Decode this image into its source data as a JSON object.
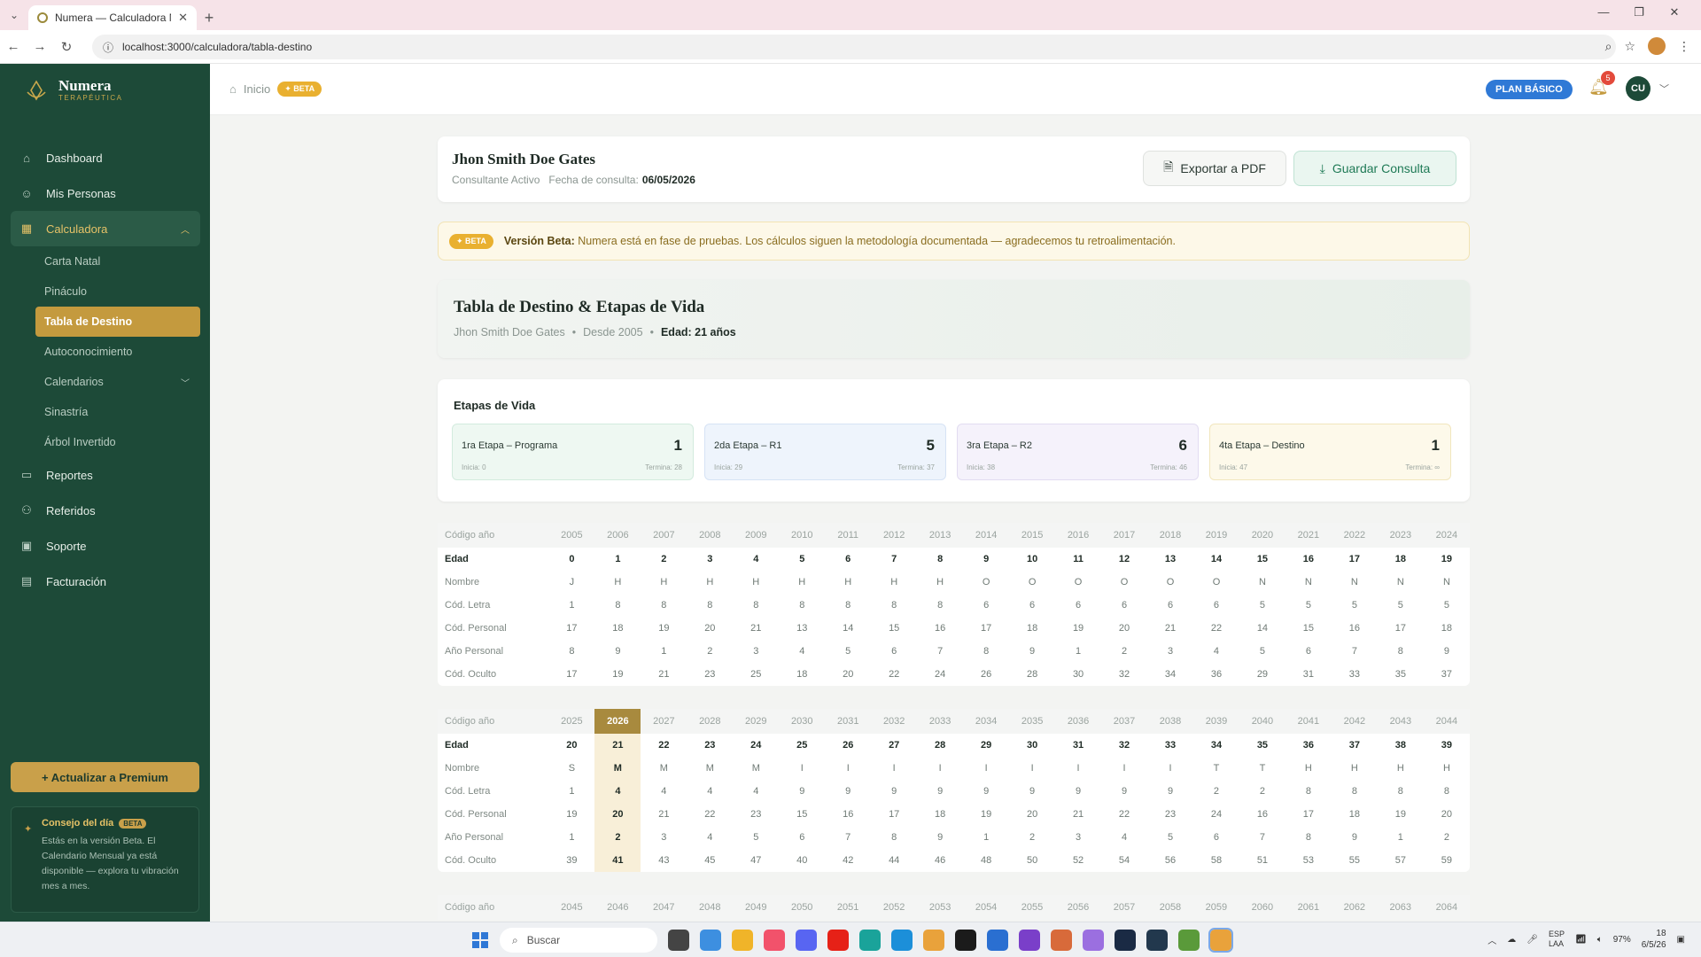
{
  "browser": {
    "tab_title": "Numera — Calculadora Numer",
    "url": "localhost:3000/calculadora/tabla-destino"
  },
  "sidebar": {
    "brand": "Numera",
    "brand_sub": "TERAPÉUTICA",
    "items": [
      {
        "label": "Dashboard",
        "icon": "home-icon"
      },
      {
        "label": "Mis Personas",
        "icon": "users-icon"
      },
      {
        "label": "Calculadora",
        "icon": "calculator-icon"
      }
    ],
    "sub_items": [
      {
        "label": "Carta Natal"
      },
      {
        "label": "Pináculo"
      },
      {
        "label": "Tabla de Destino"
      },
      {
        "label": "Autoconocimiento"
      },
      {
        "label": "Calendarios"
      },
      {
        "label": "Sinastría"
      },
      {
        "label": "Árbol Invertido"
      }
    ],
    "bottom_items": [
      {
        "label": "Reportes",
        "icon": "file-icon"
      },
      {
        "label": "Referidos",
        "icon": "referral-icon"
      },
      {
        "label": "Soporte",
        "icon": "support-icon"
      },
      {
        "label": "Facturación",
        "icon": "billing-icon"
      }
    ],
    "premium_label": "+ Actualizar a Premium",
    "tip": {
      "title": "Consejo del día",
      "badge": "BETA",
      "body": "Estás en la versión Beta. El Calendario Mensual ya está disponible — explora tu vibración mes a mes."
    }
  },
  "topbar": {
    "breadcrumb": "Inicio",
    "beta": "✦ BETA",
    "plan": "PLAN BÁSICO",
    "notifications": "5",
    "avatar": "CU"
  },
  "header": {
    "name": "Jhon Smith Doe Gates",
    "status": "Consultante Activo",
    "date_label": "Fecha de consulta:",
    "date": "06/05/2026",
    "export_label": "Exportar a PDF",
    "save_label": "Guardar Consulta"
  },
  "banner": {
    "badge": "✦ BETA",
    "bold": "Versión Beta:",
    "text": "Numera está en fase de pruebas. Los cálculos siguen la metodología documentada — agradecemos tu retroalimentación."
  },
  "title_card": {
    "title": "Tabla de Destino & Etapas de Vida",
    "name": "Jhon Smith Doe Gates",
    "since": "Desde 2005",
    "age": "Edad: 21 años"
  },
  "stages": {
    "title": "Etapas de Vida",
    "items": [
      {
        "label": "1ra Etapa – Programa",
        "num": "1",
        "start": "Inicia: 0",
        "end": "Termina: 28"
      },
      {
        "label": "2da Etapa – R1",
        "num": "5",
        "start": "Inicia: 29",
        "end": "Termina: 37"
      },
      {
        "label": "3ra Etapa – R2",
        "num": "6",
        "start": "Inicia: 38",
        "end": "Termina: 46"
      },
      {
        "label": "4ta Etapa – Destino",
        "num": "1",
        "start": "Inicia: 47",
        "end": "Termina: ∞"
      }
    ]
  },
  "table_labels": {
    "year": "Código año",
    "age": "Edad",
    "name": "Nombre",
    "letter": "Cód. Letra",
    "personal": "Cód. Personal",
    "personal_year": "Año Personal",
    "hidden": "Cód. Oculto"
  },
  "tables": [
    {
      "years": [
        "2005",
        "2006",
        "2007",
        "2008",
        "2009",
        "2010",
        "2011",
        "2012",
        "2013",
        "2014",
        "2015",
        "2016",
        "2017",
        "2018",
        "2019",
        "2020",
        "2021",
        "2022",
        "2023",
        "2024"
      ],
      "age": [
        "0",
        "1",
        "2",
        "3",
        "4",
        "5",
        "6",
        "7",
        "8",
        "9",
        "10",
        "11",
        "12",
        "13",
        "14",
        "15",
        "16",
        "17",
        "18",
        "19"
      ],
      "name": [
        "J",
        "H",
        "H",
        "H",
        "H",
        "H",
        "H",
        "H",
        "H",
        "O",
        "O",
        "O",
        "O",
        "O",
        "O",
        "N",
        "N",
        "N",
        "N",
        "N"
      ],
      "letter": [
        "1",
        "8",
        "8",
        "8",
        "8",
        "8",
        "8",
        "8",
        "8",
        "6",
        "6",
        "6",
        "6",
        "6",
        "6",
        "5",
        "5",
        "5",
        "5",
        "5"
      ],
      "personal": [
        "17",
        "18",
        "19",
        "20",
        "21",
        "13",
        "14",
        "15",
        "16",
        "17",
        "18",
        "19",
        "20",
        "21",
        "22",
        "14",
        "15",
        "16",
        "17",
        "18"
      ],
      "personal_year": [
        "8",
        "9",
        "1",
        "2",
        "3",
        "4",
        "5",
        "6",
        "7",
        "8",
        "9",
        "1",
        "2",
        "3",
        "4",
        "5",
        "6",
        "7",
        "8",
        "9"
      ],
      "hidden": [
        "17",
        "19",
        "21",
        "23",
        "25",
        "18",
        "20",
        "22",
        "24",
        "26",
        "28",
        "30",
        "32",
        "34",
        "36",
        "29",
        "31",
        "33",
        "35",
        "37"
      ]
    },
    {
      "years": [
        "2025",
        "2026",
        "2027",
        "2028",
        "2029",
        "2030",
        "2031",
        "2032",
        "2033",
        "2034",
        "2035",
        "2036",
        "2037",
        "2038",
        "2039",
        "2040",
        "2041",
        "2042",
        "2043",
        "2044"
      ],
      "age": [
        "20",
        "21",
        "22",
        "23",
        "24",
        "25",
        "26",
        "27",
        "28",
        "29",
        "30",
        "31",
        "32",
        "33",
        "34",
        "35",
        "36",
        "37",
        "38",
        "39"
      ],
      "name": [
        "S",
        "M",
        "M",
        "M",
        "M",
        "I",
        "I",
        "I",
        "I",
        "I",
        "I",
        "I",
        "I",
        "I",
        "T",
        "T",
        "H",
        "H",
        "H",
        "H"
      ],
      "letter": [
        "1",
        "4",
        "4",
        "4",
        "4",
        "9",
        "9",
        "9",
        "9",
        "9",
        "9",
        "9",
        "9",
        "9",
        "2",
        "2",
        "8",
        "8",
        "8",
        "8"
      ],
      "personal": [
        "19",
        "20",
        "21",
        "22",
        "23",
        "15",
        "16",
        "17",
        "18",
        "19",
        "20",
        "21",
        "22",
        "23",
        "24",
        "16",
        "17",
        "18",
        "19",
        "20"
      ],
      "personal_year": [
        "1",
        "2",
        "3",
        "4",
        "5",
        "6",
        "7",
        "8",
        "9",
        "1",
        "2",
        "3",
        "4",
        "5",
        "6",
        "7",
        "8",
        "9",
        "1",
        "2"
      ],
      "hidden": [
        "39",
        "41",
        "43",
        "45",
        "47",
        "40",
        "42",
        "44",
        "46",
        "48",
        "50",
        "52",
        "54",
        "56",
        "58",
        "51",
        "53",
        "55",
        "57",
        "59"
      ]
    },
    {
      "years": [
        "2045",
        "2046",
        "2047",
        "2048",
        "2049",
        "2050",
        "2051",
        "2052",
        "2053",
        "2054",
        "2055",
        "2056",
        "2057",
        "2058",
        "2059",
        "2060",
        "2061",
        "2062",
        "2063",
        "2064"
      ]
    }
  ],
  "taskbar": {
    "search": "Buscar",
    "lang": "ESP\nLAA",
    "battery": "97%",
    "time": "18",
    "date": "6/5/26"
  }
}
